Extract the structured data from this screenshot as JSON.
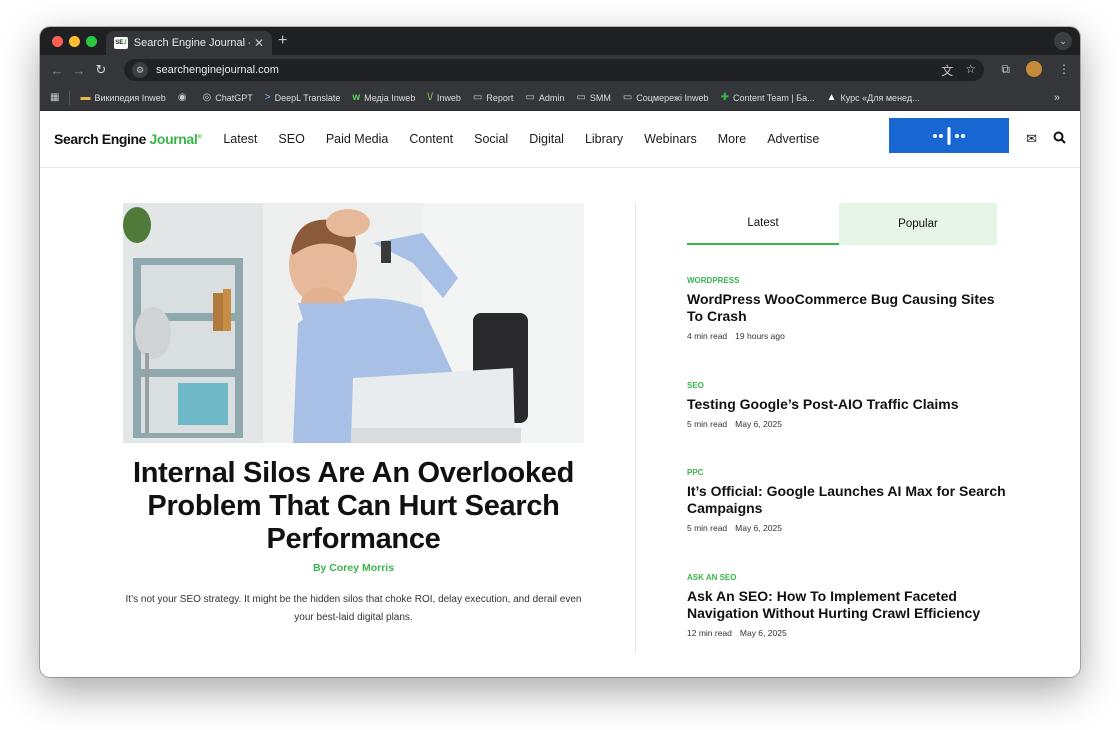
{
  "browser": {
    "tab_title": "Search Engine Journal - SEO,",
    "favicon": "SEJ",
    "url": "searchenginejournal.com",
    "bookmarks": [
      {
        "icon": "folder",
        "label": "Википедия Inweb"
      },
      {
        "icon": "globe",
        "label": ""
      },
      {
        "icon": "chatgpt",
        "label": "ChatGPT"
      },
      {
        "icon": "deepl",
        "label": "DeepL Translate"
      },
      {
        "icon": "w",
        "label": "Медіа Inweb"
      },
      {
        "icon": "inweb",
        "label": "Inweb"
      },
      {
        "icon": "folder",
        "label": "Report"
      },
      {
        "icon": "folder",
        "label": "Admin"
      },
      {
        "icon": "folder",
        "label": "SMM"
      },
      {
        "icon": "folder",
        "label": "Соцмережі Inweb"
      },
      {
        "icon": "plus",
        "label": "Content Team | Ба..."
      },
      {
        "icon": "triangle",
        "label": "Курс «Для менед..."
      }
    ],
    "bookmarks_more": "»"
  },
  "site": {
    "logo_main": "Search Engine ",
    "logo_accent": "Journal",
    "logo_mark": "®",
    "nav": [
      "Latest",
      "SEO",
      "Paid Media",
      "Content",
      "Social",
      "Digital",
      "Library",
      "Webinars",
      "More",
      "Advertise"
    ],
    "accent_color": "#3ab54a"
  },
  "hero": {
    "title": "Internal Silos Are An Overlooked Problem That Can Hurt Search Performance",
    "author": "By Corey Morris",
    "excerpt": "It’s not your SEO strategy. It might be the hidden silos that choke ROI, delay execution, and derail even your best-laid digital plans."
  },
  "sidebar": {
    "tabs": [
      "Latest",
      "Popular"
    ],
    "articles": [
      {
        "category": "WordPress",
        "title": "WordPress WooCommerce Bug Causing Sites To Crash",
        "read": "4 min read",
        "date": "19 hours ago"
      },
      {
        "category": "SEO",
        "title": "Testing Google’s Post-AIO Traffic Claims",
        "read": "5 min read",
        "date": "May 6, 2025"
      },
      {
        "category": "PPC",
        "title": "It’s Official: Google Launches AI Max for Search Campaigns",
        "read": "5 min read",
        "date": "May 6, 2025"
      },
      {
        "category": "Ask An SEO",
        "title": "Ask An SEO: How To Implement Faceted Navigation Without Hurting Crawl Efficiency",
        "read": "12 min read",
        "date": "May 6, 2025"
      }
    ]
  }
}
